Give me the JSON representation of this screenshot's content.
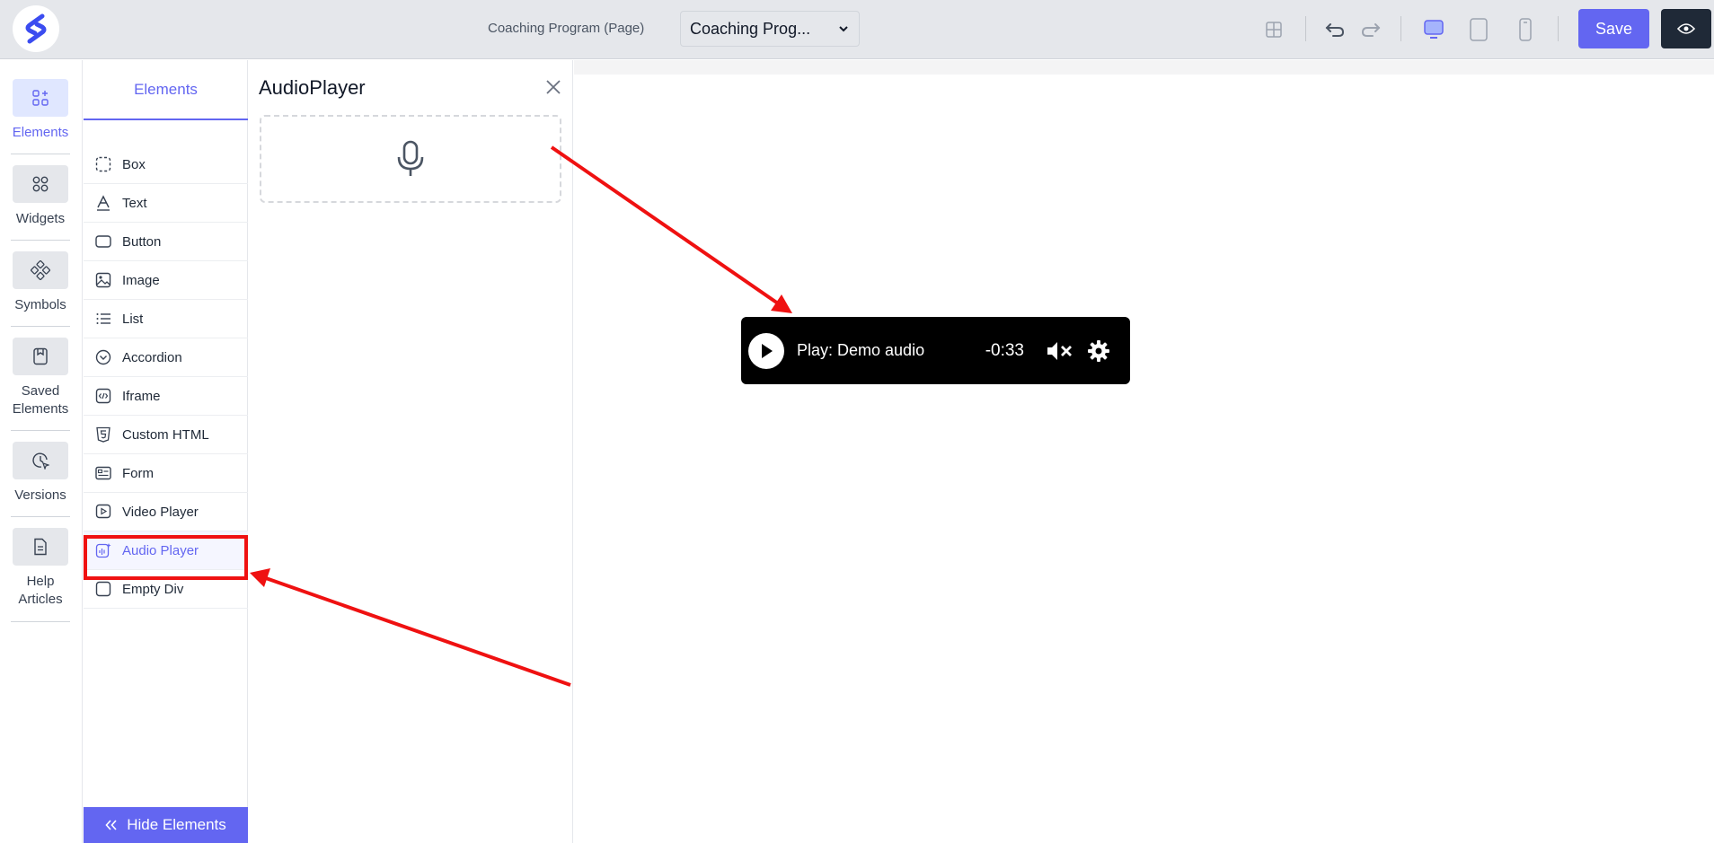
{
  "topbar": {
    "page_name": "Coaching Program (Page)",
    "page_select_value": "Coaching Prog...",
    "save_label": "Save"
  },
  "rail": {
    "items": [
      {
        "label": "Elements",
        "icon": "elements-icon",
        "active": true
      },
      {
        "label": "Widgets",
        "icon": "widgets-icon"
      },
      {
        "label": "Symbols",
        "icon": "symbols-icon"
      },
      {
        "label": "Saved Elements",
        "icon": "bookmark-icon"
      },
      {
        "label": "Versions",
        "icon": "versions-icon"
      },
      {
        "label": "Help Articles",
        "icon": "document-icon"
      }
    ]
  },
  "elements_panel": {
    "tab_label": "Elements",
    "items": [
      {
        "label": "Box",
        "icon": "box-icon"
      },
      {
        "label": "Text",
        "icon": "text-icon"
      },
      {
        "label": "Button",
        "icon": "button-icon"
      },
      {
        "label": "Image",
        "icon": "image-icon"
      },
      {
        "label": "List",
        "icon": "list-icon"
      },
      {
        "label": "Accordion",
        "icon": "accordion-icon"
      },
      {
        "label": "Iframe",
        "icon": "iframe-icon"
      },
      {
        "label": "Custom HTML",
        "icon": "html5-icon"
      },
      {
        "label": "Form",
        "icon": "form-icon"
      },
      {
        "label": "Video Player",
        "icon": "video-icon"
      },
      {
        "label": "Audio Player",
        "icon": "audio-icon",
        "selected": true
      },
      {
        "label": "Empty Div",
        "icon": "empty-div-icon"
      }
    ],
    "hide_label": "Hide Elements"
  },
  "detail_panel": {
    "title": "AudioPlayer"
  },
  "player": {
    "title": "Play: Demo audio",
    "time": "-0:33"
  },
  "colors": {
    "accent": "#6366f1",
    "annotation": "#ef1111",
    "topbar": "#e5e7eb"
  }
}
